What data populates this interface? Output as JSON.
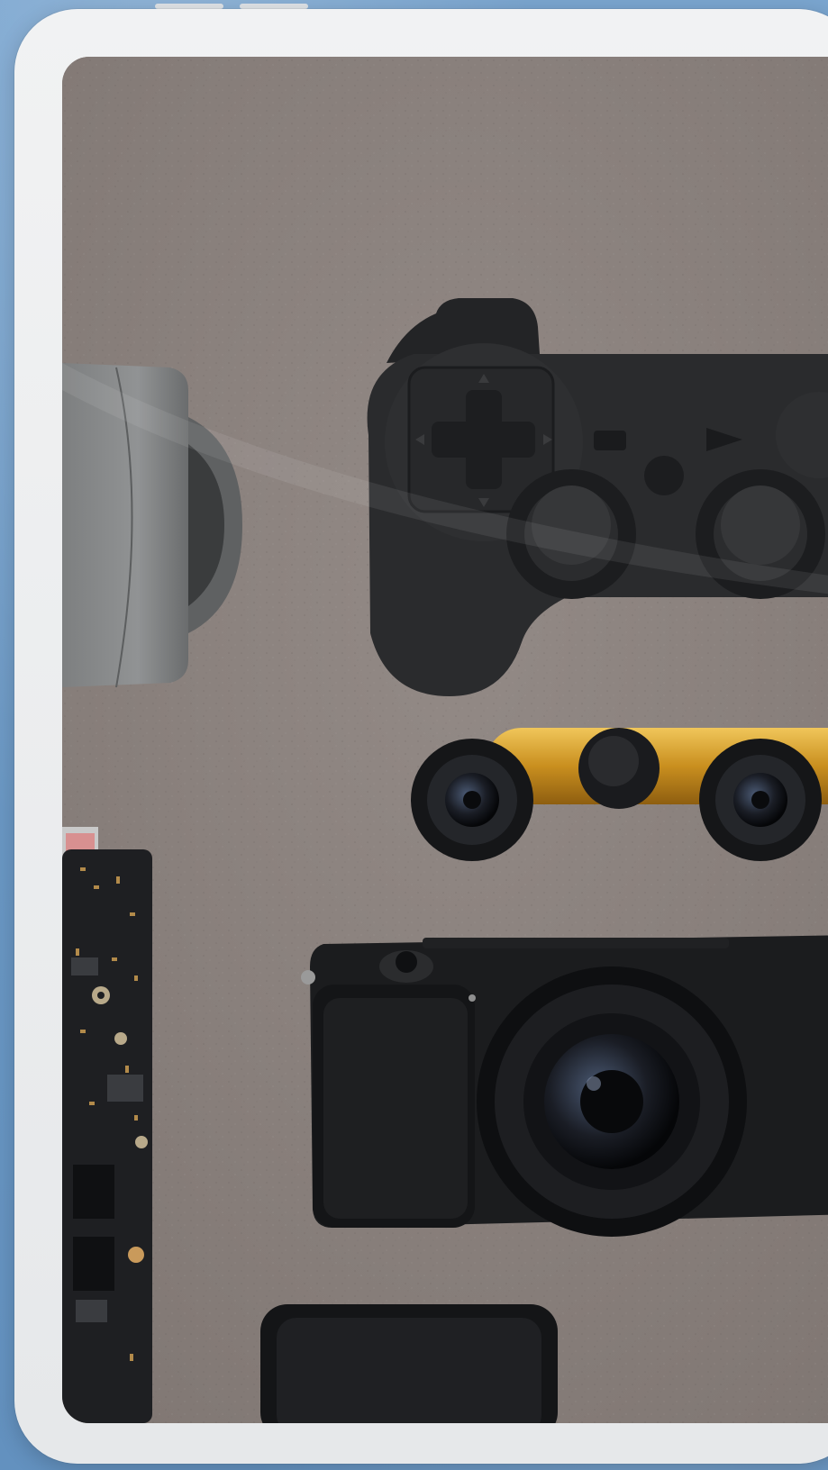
{
  "scene": {
    "background_color": "#6e9cc7",
    "frame_color": "#eceeef",
    "surface_color": "#8b827e",
    "objects": [
      "action-camera-icon",
      "game-controller-icon",
      "binoculars-icon",
      "mirrorless-camera-icon",
      "circuit-board-icon",
      "phone-case-icon"
    ]
  }
}
